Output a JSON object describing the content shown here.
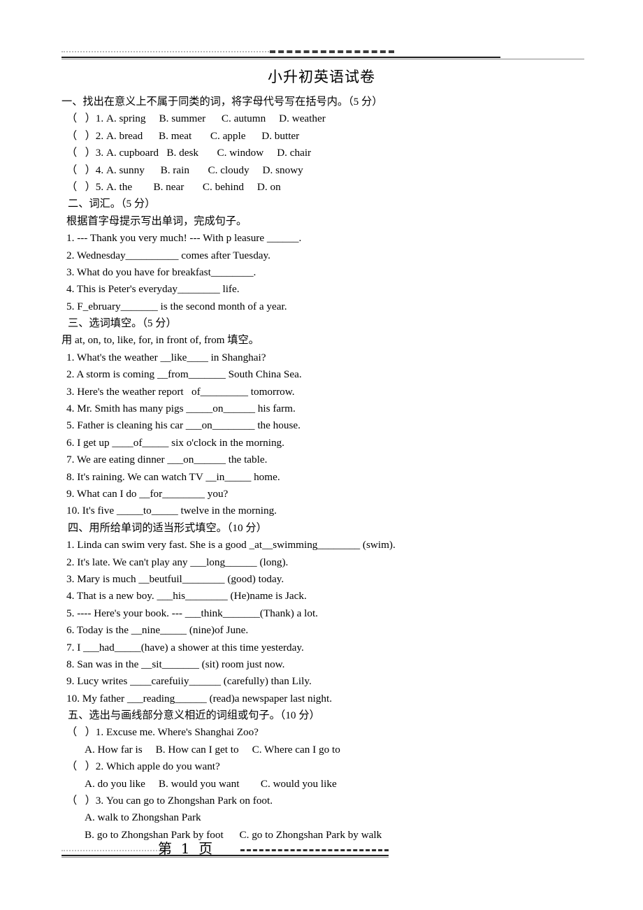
{
  "document": {
    "title": "小升初英语试卷",
    "page_label": "第  1  页"
  },
  "sections": [
    {
      "heading": "一、找出在意义上不属于同类的词，将字母代号写在括号内。（5 分）",
      "items": [
        "（   ）1. A. spring     B. summer      C. autumn     D. weather",
        "（   ）2. A. bread      B. meat       C. apple      D. butter",
        "（   ）3. A. cupboard   B. desk       C. window     D. chair",
        "（   ）4. A. sunny      B. rain       C. cloudy     D. snowy",
        "（   ）5. A. the        B. near       C. behind     D. on"
      ]
    },
    {
      "heading": "二、词汇。（5 分）",
      "subheading": "根据首字母提示写出单词，完成句子。",
      "items": [
        "1. --- Thank you very much! --- With p leasure ______.",
        "2. Wednesday__________ comes after Tuesday.",
        "3. What do you have for breakfast________.",
        "4. This is Peter's everyday________ life.",
        "5. F_ebruary_______ is the second month of a year."
      ]
    },
    {
      "heading": "三、选词填空。（5 分）",
      "subheading": "用 at, on, to, like, for, in front of, from 填空。",
      "items": [
        "1. What's the weather __like____ in Shanghai?",
        "2. A storm is coming __from_______ South China Sea.",
        "3. Here's the weather report   of_________ tomorrow.",
        "4. Mr. Smith has many pigs _____on______ his farm.",
        "5. Father is cleaning his car ___on________ the house.",
        "6. I get up ____of_____ six o'clock in the morning.",
        "7. We are eating dinner ___on______ the table.",
        "8. It's raining. We can watch TV __in_____ home.",
        "9. What can I do __for________ you?",
        "10. It's five _____to_____ twelve in the morning."
      ]
    },
    {
      "heading": "四、用所给单词的适当形式填空。（10 分）",
      "items": [
        "1. Linda can swim very fast. She is a good _at__swimming________ (swim).",
        "2. It's late. We can't play any ___long______ (long).",
        "3. Mary is much __beutfuil________ (good) today.",
        "4. That is a new boy. ___his________ (He)name is Jack.",
        "5. ---- Here's your book. --- ___think_______(Thank) a lot.",
        "6. Today is the __nine_____ (nine)of June.",
        "7. I ___had_____(have) a shower at this time yesterday.",
        "8. San was in the __sit_______ (sit) room just now.",
        "9. Lucy writes ____carefuiiy______ (carefully) than Lily.",
        "10. My father ___reading______ (read)a newspaper last night."
      ]
    },
    {
      "heading": "五、选出与画线部分意义相近的词组或句子。（10 分）",
      "questions": [
        {
          "stem": "（   ）1. Excuse me. Where's Shanghai Zoo?",
          "options": [
            "A. How far is     B. How can I get to     C. Where can I go to"
          ]
        },
        {
          "stem": "（   ）2. Which apple do you want?",
          "options": [
            "A. do you like     B. would you want        C. would you like"
          ]
        },
        {
          "stem": "（   ）3. You can go to Zhongshan Park on foot.",
          "options": [
            "A. walk to Zhongshan Park",
            "B. go to Zhongshan Park by foot      C. go to Zhongshan Park by walk"
          ]
        }
      ]
    }
  ]
}
